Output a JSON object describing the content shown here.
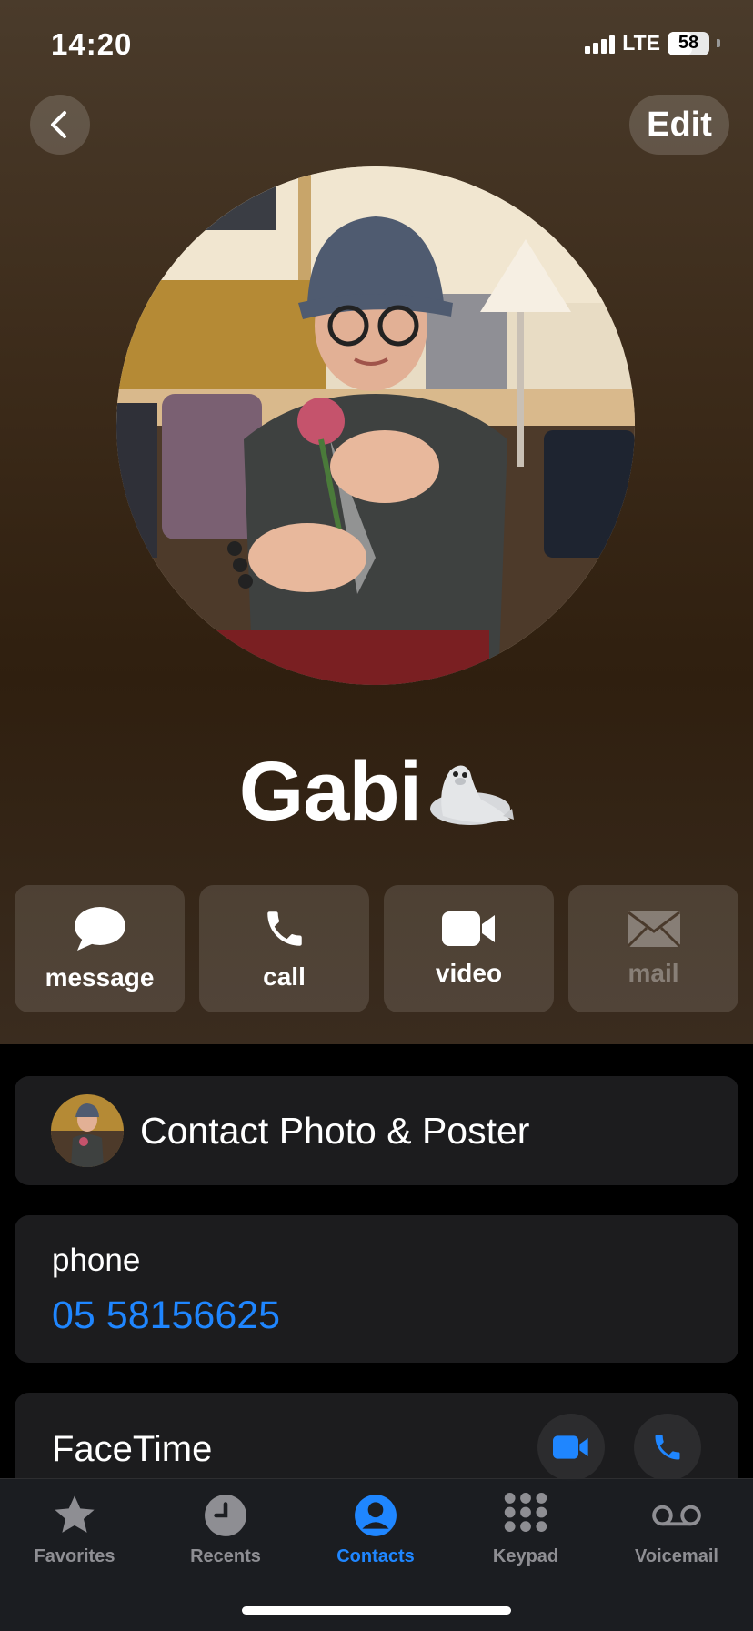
{
  "status_bar": {
    "time": "14:20",
    "network": "LTE",
    "battery": "58",
    "battery_level": 0.58
  },
  "nav": {
    "edit_label": "Edit",
    "back_icon": "chevron-left-icon"
  },
  "contact": {
    "name": "Gabi",
    "emoji": "🦭"
  },
  "actions": [
    {
      "label": "message",
      "icon": "message-bubble-icon",
      "enabled": true
    },
    {
      "label": "call",
      "icon": "phone-icon",
      "enabled": true
    },
    {
      "label": "video",
      "icon": "video-camera-icon",
      "enabled": true
    },
    {
      "label": "mail",
      "icon": "envelope-icon",
      "enabled": false
    }
  ],
  "poster_row": {
    "label": "Contact Photo & Poster"
  },
  "phone": {
    "label": "phone",
    "number": "05 58156625"
  },
  "facetime": {
    "label": "FaceTime"
  },
  "tabs": [
    {
      "label": "Favorites",
      "icon": "star-icon",
      "active": false
    },
    {
      "label": "Recents",
      "icon": "clock-icon",
      "active": false
    },
    {
      "label": "Contacts",
      "icon": "person-circle-icon",
      "active": true
    },
    {
      "label": "Keypad",
      "icon": "keypad-icon",
      "active": false
    },
    {
      "label": "Voicemail",
      "icon": "voicemail-icon",
      "active": false
    }
  ],
  "colors": {
    "accent": "#1f86ff",
    "card_bg": "#1c1c1e",
    "header_brown": "#3c2b1a"
  }
}
